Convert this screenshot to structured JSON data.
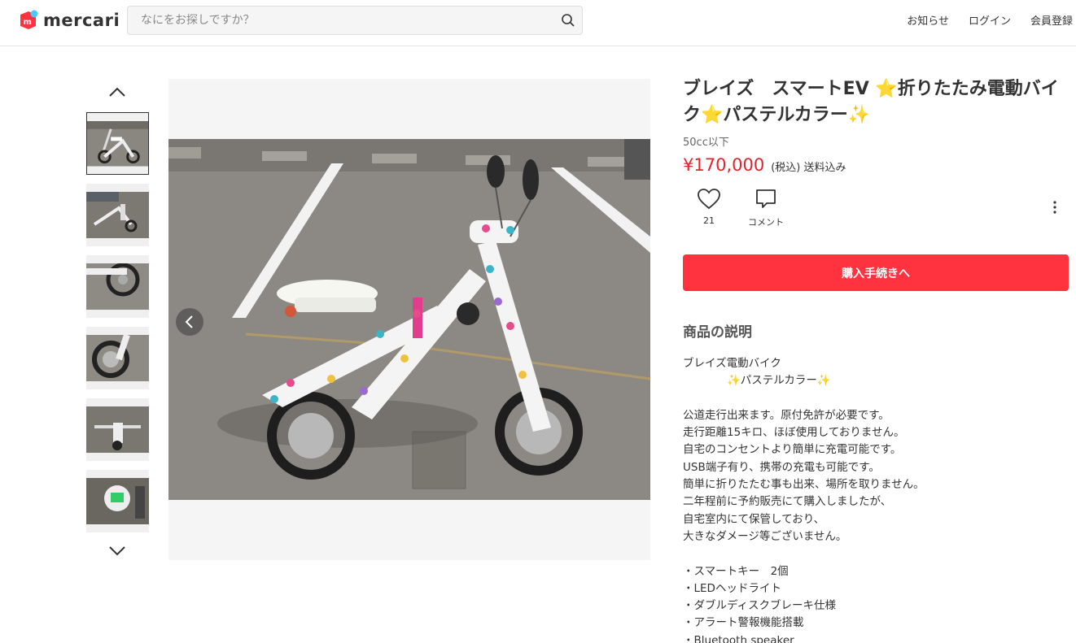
{
  "header": {
    "logo_text": "mercari",
    "search_placeholder": "なにをお探しですか？",
    "nav": [
      "お知らせ",
      "ログイン",
      "会員登録"
    ]
  },
  "product": {
    "title": "ブレイズ　スマートEV ⭐折りたたみ電動バイク⭐パステルカラー✨",
    "category": "50cc以下",
    "price": "¥170,000",
    "tax_shipping": "(税込) 送料込み",
    "like_count": "21",
    "comment_label": "コメント",
    "buy_label": "購入手続きへ",
    "description_heading": "商品の説明",
    "description": "ブレイズ電動バイク\n　　　　✨パステルカラー✨\n\n公道走行出来ます。原付免許が必要です。\n走行距離15キロ、ほぼ使用しておりません。\n自宅のコンセントより簡単に充電可能です。\nUSB端子有り、携帯の充電も可能です。\n簡単に折りたたむ事も出来、場所を取りません。\n二年程前に予約販売にて購入しましたが、\n自宅室内にて保管しており、\n大きなダメージ等ございません。\n\n・スマートキー　2個\n・LEDヘッドライト\n・ダブルディスクブレーキ仕様\n・アラート警報機能搭載\n・Bluetooth speaker"
  },
  "colors": {
    "accent": "#ff333f",
    "price": "#e0232c",
    "logo_red": "#ff333f",
    "logo_blue": "#4dc9ff"
  },
  "icons": [
    "search-icon",
    "chevron-up-icon",
    "chevron-down-icon",
    "chevron-left-icon",
    "chevron-right-icon",
    "heart-icon",
    "comment-icon",
    "more-vertical-icon"
  ]
}
